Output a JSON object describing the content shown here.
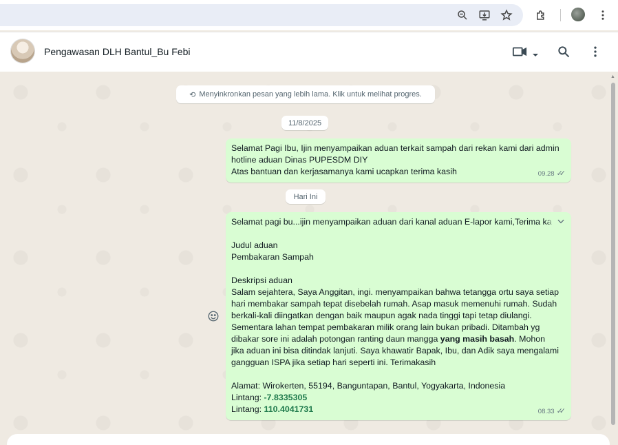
{
  "browser": {
    "icons": [
      "zoom-out-icon",
      "install-app-icon",
      "bookmark-star-icon",
      "extensions-icon",
      "profile-avatar",
      "more-vert-icon"
    ]
  },
  "header": {
    "contact_name": "Pengawasan DLH Bantul_Bu Febi"
  },
  "chat": {
    "sync_notice": "Menyinkronkan pesan yang lebih lama. Klik untuk melihat progres.",
    "dates": [
      "11/8/2025",
      "Hari Ini"
    ],
    "messages": [
      {
        "lines": [
          "Selamat Pagi Ibu, Ijin menyampaikan aduan terkait sampah dari rekan kami dari admin",
          "hotline aduan Dinas PUPESDM DIY",
          "Atas bantuan dan kerjasamanya kami ucapkan terima kasih"
        ],
        "time": "09.28"
      },
      {
        "intro": "Selamat pagi bu...ijin menyampaikan aduan dari kanal aduan E-lapor kami,Terima ka",
        "judul_label": "Judul aduan",
        "judul_value": "Pembakaran Sampah",
        "desc_label": "Deskripsi aduan",
        "desc_lines": [
          "Salam sejahtera, Saya Anggitan, ingi. menyampaikan bahwa tetangga ortu saya setiap",
          "hari membakar sampah tepat disebelah rumah. Asap masuk memenuhi rumah. Sudah",
          "berkali-kali diingatkan dengan baik maupun agak nada tinggi tapi tetap diulangi.",
          "Sementara lahan tempat pembakaran milik orang lain bukan pribadi. Ditambah yg"
        ],
        "desc_line5_pre": "dibakar sore ini adalah potongan ranting daun mangga ",
        "desc_line5_bold": "yang masih basah",
        "desc_line5_post": ". Mohon",
        "desc_tail": [
          "jika aduan ini bisa ditindak lanjuti. Saya khawatir Bapak, Ibu, dan Adik saya mengalami",
          "gangguan ISPA jika setiap hari seperti ini. Terimakasih"
        ],
        "alamat": "Alamat: Wirokerten, 55194, Banguntapan, Bantul, Yogyakarta, Indonesia",
        "lintang1_label": "Lintang: ",
        "lintang1_value": "-7.8335305",
        "lintang2_label": "Lintang: ",
        "lintang2_value": "110.4041731",
        "time": "08.33"
      }
    ]
  }
}
